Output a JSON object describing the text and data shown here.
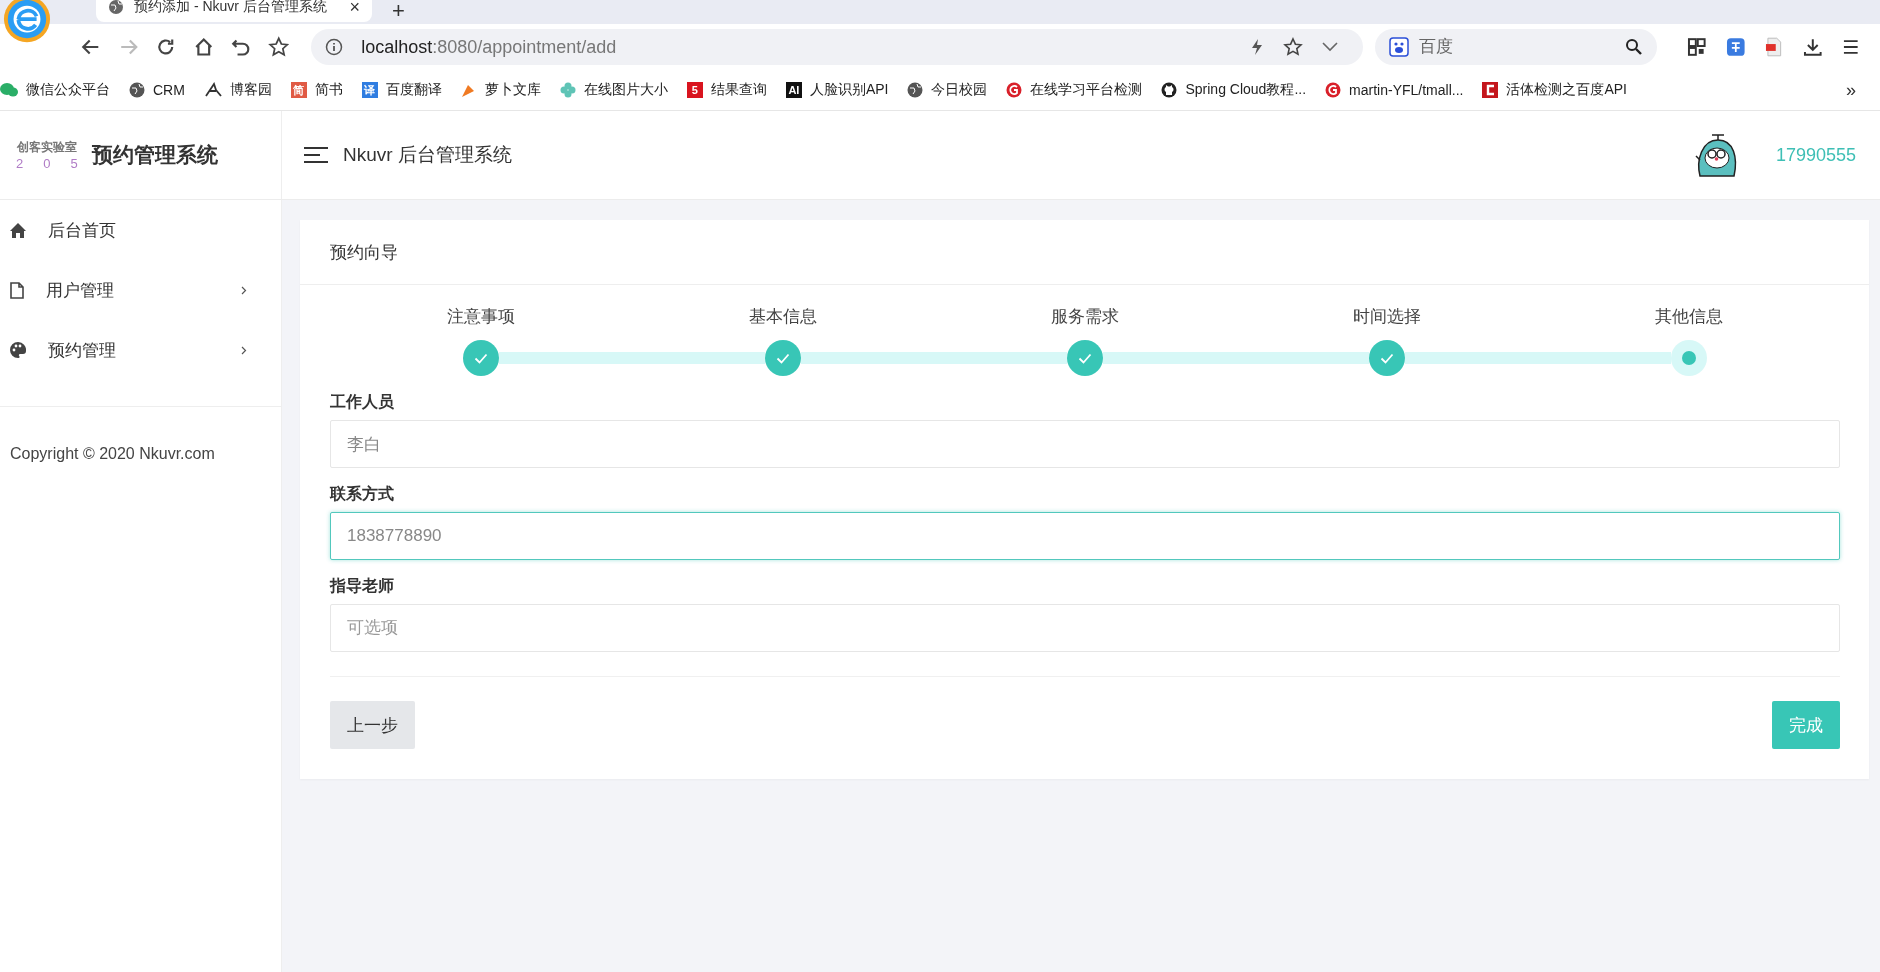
{
  "browser": {
    "tab": {
      "title": "预约添加 - Nkuvr 后台管理系统",
      "close": "×"
    },
    "new_tab": "+",
    "address": {
      "host": "localhost",
      "path": ":8080/appointment/add"
    },
    "search": {
      "placeholder": "百度"
    },
    "bookmarks": [
      {
        "label": "微信公众平台",
        "kind": "chat",
        "color": "#2aae67"
      },
      {
        "label": "CRM",
        "kind": "globe",
        "color": "#555555"
      },
      {
        "label": "博客园",
        "kind": "pen",
        "color": "#333333"
      },
      {
        "label": "简书",
        "kind": "badge",
        "badge": "简",
        "color": "#e05a44"
      },
      {
        "label": "百度翻译",
        "kind": "badge",
        "badge": "译",
        "color": "#2f7de1"
      },
      {
        "label": "萝卜文库",
        "kind": "carrot",
        "color": "#f07a22"
      },
      {
        "label": "在线图片大小",
        "kind": "flower",
        "color": "#5fc4b6"
      },
      {
        "label": "结果查询",
        "kind": "badge",
        "badge": "5",
        "color": "#d9141f"
      },
      {
        "label": "人脸识别API",
        "kind": "badge",
        "badge": "AI",
        "color": "#111111"
      },
      {
        "label": "今日校园",
        "kind": "globe",
        "color": "#555555"
      },
      {
        "label": "在线学习平台检测",
        "kind": "ring",
        "color": "#d9202a"
      },
      {
        "label": "Spring Cloud教程...",
        "kind": "cat",
        "color": "#222222"
      },
      {
        "label": "martin-YFL/tmall...",
        "kind": "ring",
        "color": "#d9202a"
      },
      {
        "label": "活体检测之百度API",
        "kind": "square",
        "color": "#c4161c"
      }
    ],
    "more": "»"
  },
  "app": {
    "logo": {
      "top": "创客实验室",
      "digits": [
        "2",
        "0",
        "5"
      ]
    },
    "system_name": "预约管理系统",
    "header_title": "Nkuvr 后台管理系统",
    "user": "17990555"
  },
  "sidebar": {
    "items": [
      {
        "label": "后台首页",
        "kind": "home",
        "expandable": false
      },
      {
        "label": "用户管理",
        "kind": "file",
        "expandable": true
      },
      {
        "label": "预约管理",
        "kind": "palette",
        "expandable": true
      }
    ],
    "copyright": "Copyright © 2020 Nkuvr.com"
  },
  "card": {
    "title": "预约向导",
    "steps": [
      {
        "label": "注意事项",
        "done": true
      },
      {
        "label": "基本信息",
        "done": true
      },
      {
        "label": "服务需求",
        "done": true
      },
      {
        "label": "时间选择",
        "done": true
      },
      {
        "label": "其他信息",
        "done": false
      }
    ],
    "fields": [
      {
        "label": "工作人员",
        "value": "李白",
        "focused": false
      },
      {
        "label": "联系方式",
        "value": "1838778890",
        "focused": true
      },
      {
        "label": "指导老师",
        "placeholder": "可选项",
        "focused": false
      }
    ],
    "buttons": {
      "previous": "上一步",
      "finish": "完成"
    }
  }
}
